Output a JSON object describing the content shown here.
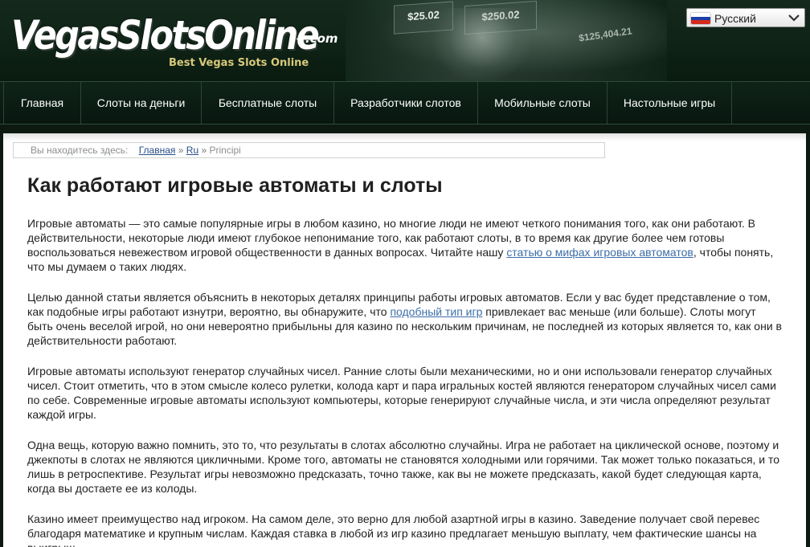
{
  "header": {
    "logo_text": "VegasSlotsOnline",
    "logo_domain": ".com",
    "logo_tagline": "Best Vegas Slots Online",
    "art_tiles": [
      "$25.02",
      "$250.02"
    ],
    "art_jackpot": "$125,404.21",
    "language": {
      "label": "Русский",
      "flag_colors": [
        "#ffffff",
        "#1c3fa8",
        "#d52b1e"
      ]
    }
  },
  "nav": {
    "items": [
      {
        "label": "Главная"
      },
      {
        "label": "Слоты на деньги"
      },
      {
        "label": "Бесплатные слоты"
      },
      {
        "label": "Разработчики слотов"
      },
      {
        "label": "Мобильные слоты"
      },
      {
        "label": "Настольные игры"
      }
    ]
  },
  "breadcrumb": {
    "prefix": "Вы находитесь здесь:",
    "home": "Главная",
    "sep1": "»",
    "ru": "Ru",
    "sep2": "»",
    "current": "Principi"
  },
  "article": {
    "title": "Как работают игровые автоматы и слоты",
    "p1_before": "Игровые автоматы — это самые популярные игры в любом казино, но многие люди не имеют четкого понимания того, как они работают. В действительности, некоторые люди имеют глубокое непонимание того, как работают слоты, в то время как другие более чем готовы воспользоваться невежеством игровой общественности в данных вопросах. Читайте нашу ",
    "p1_link": "статью о мифах игровых автоматов",
    "p1_after": ", чтобы понять, что мы думаем о таких людях.",
    "p2_before": "Целью данной статьи является объяснить в некоторых деталях принципы работы игровых автоматов. Если у вас будет представление о том, как подобные игры работают изнутри, вероятно, вы обнаружите, что ",
    "p2_link": "подобный тип игр",
    "p2_after": " привлекает вас меньше (или больше). Слоты могут быть очень веселой игрой, но они невероятно прибыльны для казино по нескольким причинам, не последней из которых является то, как они в действительности работают.",
    "p3": "Игровые автоматы используют генератор случайных чисел. Ранние слоты были механическими, но и они использовали генератор случайных чисел. Стоит отметить, что в этом смысле колесо рулетки, колода карт и пара игральных костей являются генератором случайных чисел сами по себе. Современные игровые автоматы используют компьютеры, которые генерируют случайные числа, и эти числа определяют результат каждой игры.",
    "p4": "Одна вещь, которую важно помнить, это то, что результаты в слотах абсолютно случайны. Игра не работает на циклической основе, поэтому и джекпоты в слотах не являются цикличными. Кроме того, автоматы не становятся холодными или горячими. Так может только показаться, и то лишь в ретроспективе. Результат игры невозможно предсказать, точно также, как вы не можете предсказать, какой будет следующая карта, когда вы достаете ее из колоды.",
    "p5": "Казино имеет преимущество над игроком. На самом деле, это верно для любой азартной игры в казино. Заведение получает свой перевес благодаря математике и крупным числам. Каждая ставка в любой из игр казино предлагает меньшую выплату, чем фактические шансы на выигрыш."
  }
}
